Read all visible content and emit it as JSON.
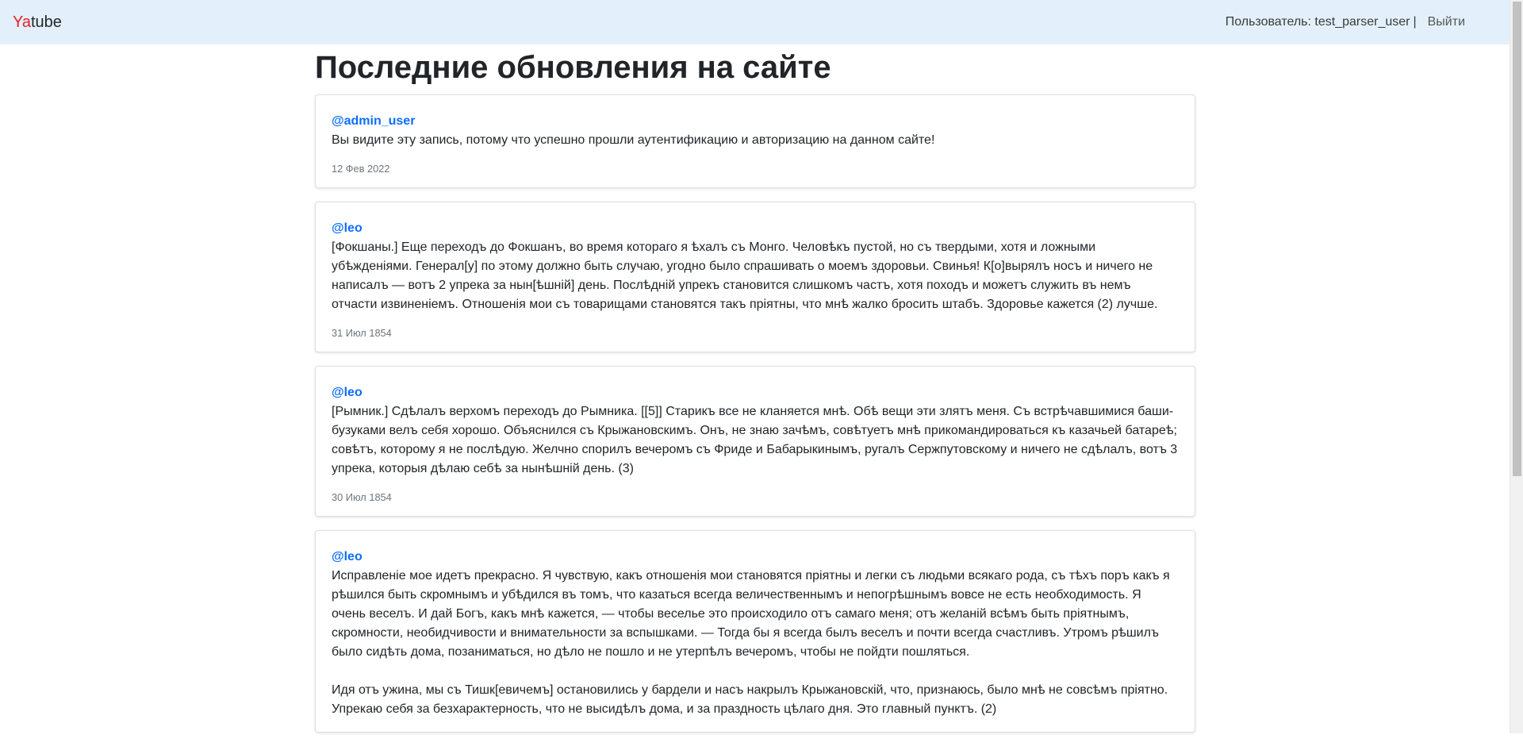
{
  "navbar": {
    "brand_ya": "Ya",
    "brand_rest": "tube",
    "user_label": "Пользователь: test_parser_user",
    "separator": "|",
    "logout_label": "Выйти"
  },
  "page": {
    "title": "Последние обновления на сайте"
  },
  "posts": [
    {
      "author": "@admin_user",
      "paragraphs": [
        "Вы видите эту запись, потому что успешно прошли аутентификацию и авторизацию на данном сайте!"
      ],
      "date": "12 Фев 2022"
    },
    {
      "author": "@leo",
      "paragraphs": [
        "[Фокшаны.] Еще переходъ до Фокшанъ, во время котораго я ѣхалъ съ Монго. Человѣкъ пустой, но съ твердыми, хотя и ложными убѣжденіями. Генерал[у] по этому должно быть случаю, угодно было спрашивать о моемъ здоровьи. Свинья! К[о]вырялъ носъ и ничего не написалъ — вотъ 2 упрека за нын[ѣшній] день. Послѣдній упрекъ становится слишкомъ частъ, хотя походъ и можетъ служить въ немъ отчасти извиненіемъ. Отношенія мои съ товарищами становятся такъ пріятны, что мнѣ жалко бросить штабъ. Здоровье кажется (2) лучше."
      ],
      "date": "31 Июл 1854"
    },
    {
      "author": "@leo",
      "paragraphs": [
        "[Рымник.] Сдѣлалъ верхомъ переходъ до Рымника. [[5]] Старикъ все не кланяется мнѣ. Обѣ вещи эти злятъ меня. Съ встрѣчавшимися баши-бузуками велъ себя хорошо. Объяснился съ Крыжановскимъ. Онъ, не знаю зачѣмъ, совѣтуетъ мнѣ прикомандироваться къ казачьей батареѣ; совѣтъ, которому я не послѣдую. Желчно спорилъ вечеромъ съ Фриде и Бабарыкинымъ, ругалъ Сержпутовскому и ничего не сдѣлалъ, вотъ 3 упрека, которыя дѣлаю себѣ за нынѣшній день. (3)"
      ],
      "date": "30 Июл 1854"
    },
    {
      "author": "@leo",
      "paragraphs": [
        "Исправленіе мое идетъ прекрасно. Я чувствую, какъ отношенія мои становятся пріятны и легки съ людьми всякаго рода, съ тѣхъ поръ какъ я рѣшился быть скромнымъ и убѣдился въ томъ, что казаться всегда величественнымъ и непогрѣшнымъ вовсе не есть необходимость. Я очень веселъ. И дай Богъ, какъ мнѣ кажется, — чтобы веселье это происходило отъ самаго меня; отъ желаній всѣмъ быть пріятнымъ, скромности, необидчивости и внимательности за вспышками. — Тогда бы я всегда былъ веселъ и почти всегда счастливъ. Утромъ рѣшилъ было сидѣть дома, позаниматься, но дѣло не пошло и не утерпѣлъ вечеромъ, чтобы не пойдти пошляться.",
        "Идя отъ ужина, мы съ Тишк[евичемъ] остановились у бардели и насъ накрылъ Крыжановскій, что, признаюсь, было мнѣ не совсѣмъ пріятно. Упрекаю себя за безхарактерность, что не высидѣлъ дома, и за праздность цѣлаго дня. Это главный пунктъ. (2)"
      ],
      "date": ""
    }
  ]
}
